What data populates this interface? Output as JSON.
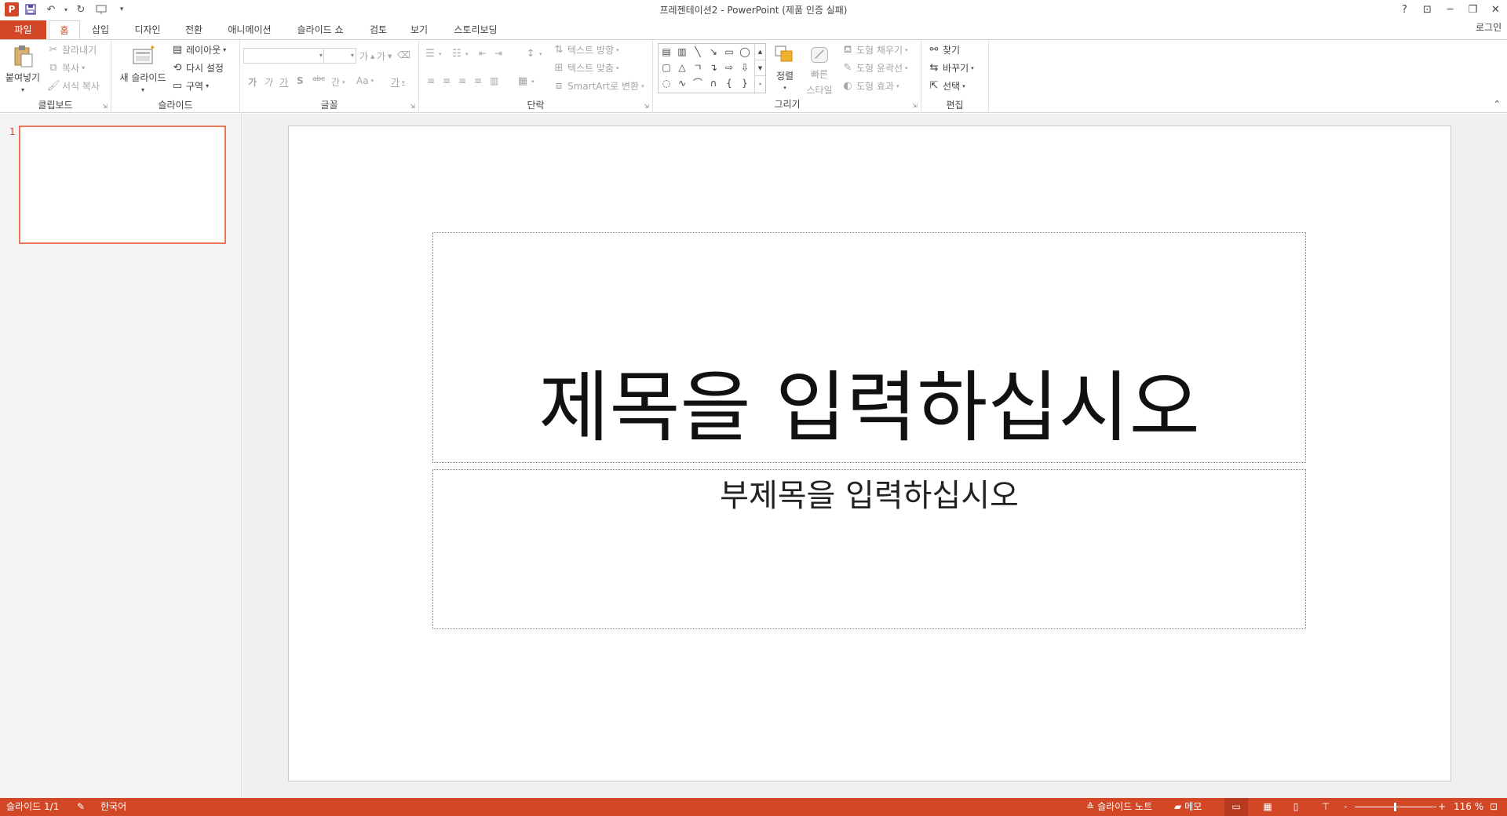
{
  "titlebar": {
    "title": "프레젠테이션2 - PowerPoint (제품 인증 실패)",
    "logo": "P",
    "qat_icons": [
      "save-icon",
      "undo-icon",
      "redo-icon",
      "presentation-icon",
      "customize-icon"
    ],
    "help": "?",
    "ribbon_display": "⊡",
    "minimize": "─",
    "restore": "❐",
    "close": "✕"
  },
  "tabs": {
    "file": "파일",
    "home": "홈",
    "insert": "삽입",
    "design": "디자인",
    "transitions": "전환",
    "animations": "애니메이션",
    "slideshow": "슬라이드 쇼",
    "review": "검토",
    "view": "보기",
    "storyboarding": "스토리보딩",
    "login": "로그인"
  },
  "ribbon": {
    "clipboard": {
      "label": "클립보드",
      "paste": "붙여넣기",
      "cut": "잘라내기",
      "copy": "복사",
      "format_painter": "서식 복사"
    },
    "slides": {
      "label": "슬라이드",
      "new_slide": "새 슬라이드",
      "layout": "레이아웃",
      "reset": "다시 설정",
      "section": "구역"
    },
    "font": {
      "label": "글꼴",
      "grow": "가",
      "shrink": "가",
      "clear": "가",
      "bold": "가",
      "italic": "가",
      "underline": "가",
      "shadow": "S",
      "strike": "abc",
      "spacing": "간",
      "case": "Aa",
      "color": "가"
    },
    "paragraph": {
      "label": "단락",
      "text_direction": "텍스트 방향",
      "align_text": "텍스트 맞춤",
      "smartart": "SmartArt로 변환"
    },
    "drawing": {
      "label": "그리기",
      "arrange": "정렬",
      "quick_styles_1": "빠른",
      "quick_styles_2": "스타일",
      "shape_fill": "도형 채우기",
      "shape_outline": "도형 윤곽선",
      "shape_effects": "도형 효과"
    },
    "editing": {
      "label": "편집",
      "find": "찾기",
      "replace": "바꾸기",
      "select": "선택"
    }
  },
  "thumbnails": {
    "slide_number": "1"
  },
  "slide": {
    "title_placeholder": "제목을 입력하십시오",
    "subtitle_placeholder": "부제목을 입력하십시오"
  },
  "statusbar": {
    "slide_info": "슬라이드 1/1",
    "language": "한국어",
    "notes": "슬라이드 노트",
    "comments": "메모",
    "zoom_minus": "-",
    "zoom_plus": "+",
    "zoom_value": "116 %"
  },
  "colors": {
    "accent": "#d24726",
    "thumb_border": "#e8765a"
  }
}
